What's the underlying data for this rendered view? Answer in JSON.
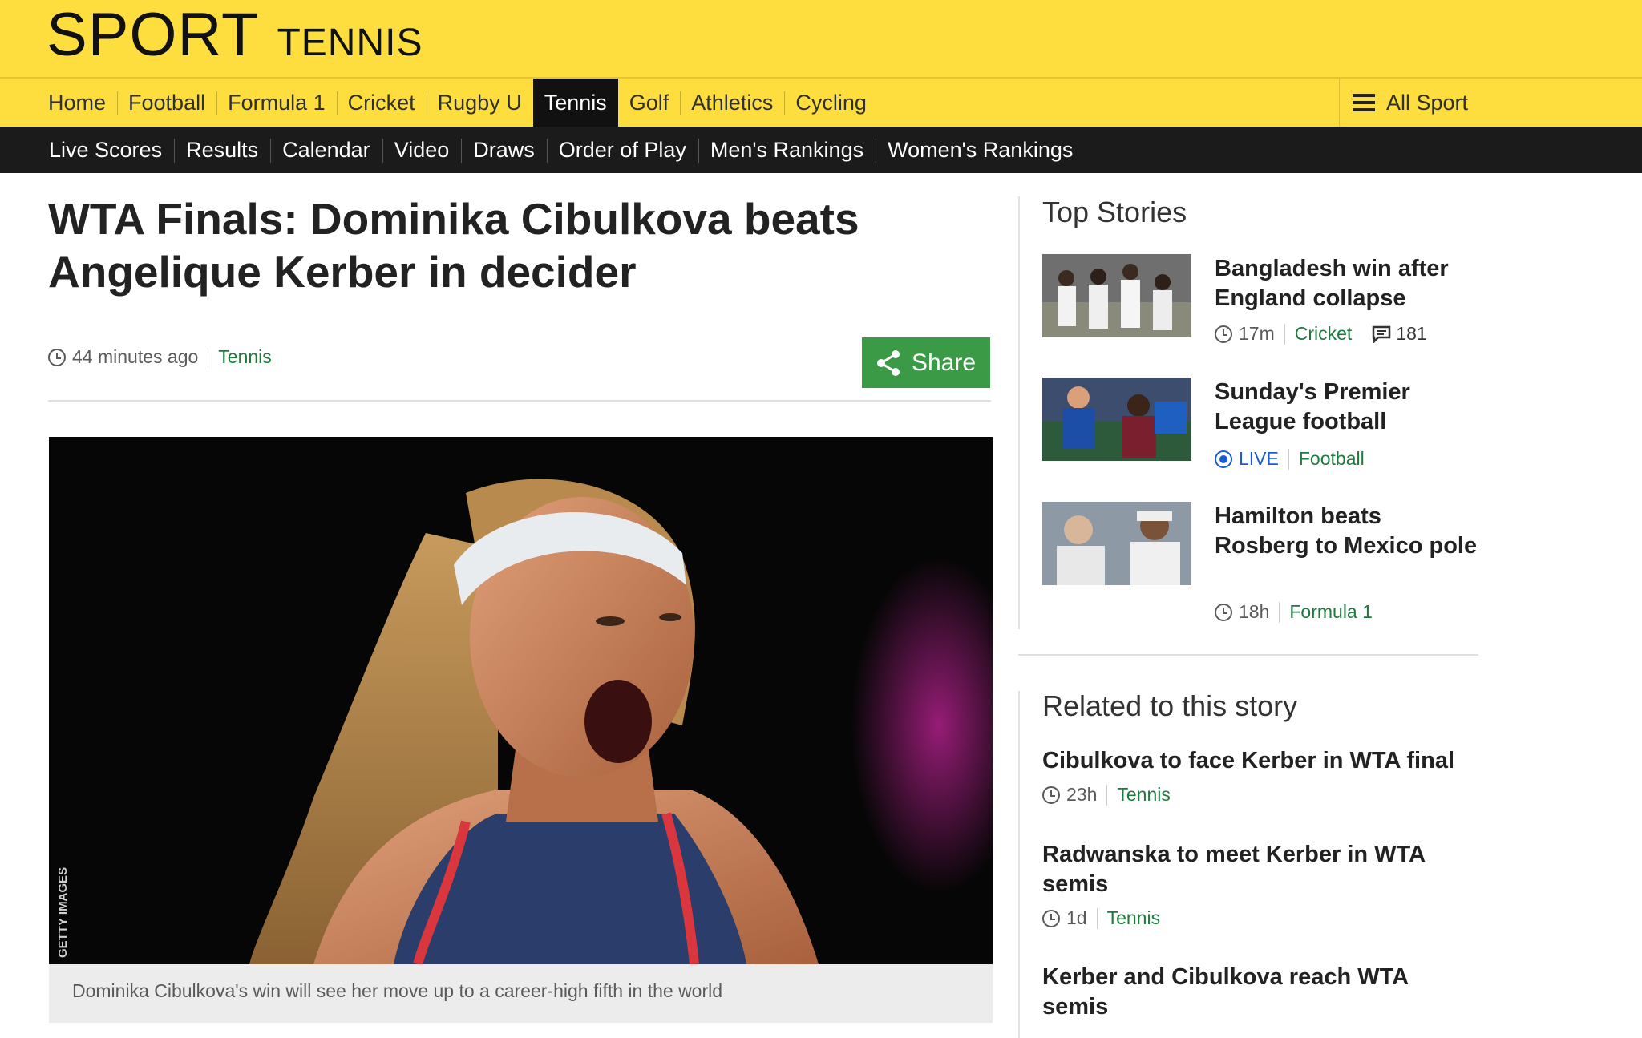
{
  "masthead": {
    "sport": "SPORT",
    "section": "TENNIS"
  },
  "primary_nav": {
    "items": [
      {
        "label": "Home"
      },
      {
        "label": "Football"
      },
      {
        "label": "Formula 1"
      },
      {
        "label": "Cricket"
      },
      {
        "label": "Rugby U"
      },
      {
        "label": "Tennis",
        "active": true
      },
      {
        "label": "Golf"
      },
      {
        "label": "Athletics"
      },
      {
        "label": "Cycling"
      }
    ],
    "all_sport": "All Sport"
  },
  "secondary_nav": {
    "items": [
      {
        "label": "Live Scores"
      },
      {
        "label": "Results"
      },
      {
        "label": "Calendar"
      },
      {
        "label": "Video"
      },
      {
        "label": "Draws"
      },
      {
        "label": "Order of Play"
      },
      {
        "label": "Men's Rankings"
      },
      {
        "label": "Women's Rankings"
      }
    ]
  },
  "article": {
    "headline": "WTA Finals: Dominika Cibulkova beats Angelique Kerber in decider",
    "time": "44 minutes ago",
    "tag": "Tennis",
    "share_label": "Share",
    "photo_credit": "GETTY IMAGES",
    "caption": "Dominika Cibulkova's win will see her move up to a career-high fifth in the world"
  },
  "top_stories": {
    "title": "Top Stories",
    "items": [
      {
        "title": "Bangladesh win after England collapse",
        "time": "17m",
        "tag": "Cricket",
        "comments": "181"
      },
      {
        "title": "Sunday's Premier League football",
        "live": "LIVE",
        "tag": "Football"
      },
      {
        "title": "Hamilton beats Rosberg to Mexico pole",
        "time": "18h",
        "tag": "Formula 1"
      }
    ]
  },
  "related": {
    "title": "Related to this story",
    "items": [
      {
        "title": "Cibulkova to face Kerber in WTA final",
        "time": "23h",
        "tag": "Tennis"
      },
      {
        "title": "Radwanska to meet Kerber in WTA semis",
        "time": "1d",
        "tag": "Tennis"
      },
      {
        "title": "Kerber and Cibulkova reach WTA semis"
      }
    ]
  },
  "colors": {
    "masthead": "#fedd3e",
    "nav_dark": "#1b1b1b",
    "share_green": "#3b9a46",
    "link_green": "#1e7a3e",
    "live_blue": "#1a5bd6"
  }
}
